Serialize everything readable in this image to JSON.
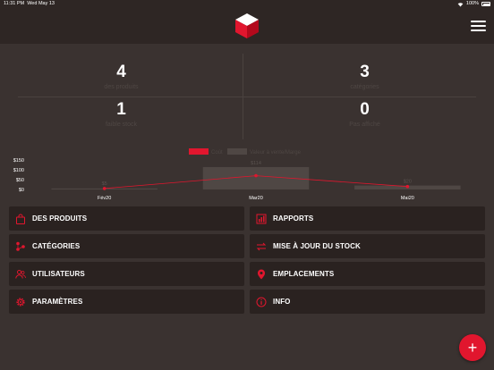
{
  "status": {
    "time": "11:31 PM",
    "date": "Wed May 13",
    "battery": "100%"
  },
  "colors": {
    "accent": "#e1162e",
    "background": "#3a3230",
    "header": "#2e2624",
    "tile": "#2a2220"
  },
  "stats": [
    {
      "value": "4",
      "label": "des produits"
    },
    {
      "value": "3",
      "label": "catégories"
    },
    {
      "value": "1",
      "label": "faible stock"
    },
    {
      "value": "0",
      "label": "Pas affiché"
    }
  ],
  "chart_data": {
    "type": "bar",
    "legend": [
      "Coût",
      "Valeur à vente/Marge"
    ],
    "categories": [
      "Fév20",
      "Mar20",
      "Mai20"
    ],
    "series": [
      {
        "name": "Coût",
        "type": "line",
        "values": [
          5,
          70,
          15
        ]
      },
      {
        "name": "Valeur à vente/Marge",
        "type": "bar",
        "values": [
          5,
          114,
          20
        ]
      }
    ],
    "bar_labels": [
      "",
      "$114",
      "$20"
    ],
    "point_labels": [
      "$5",
      "",
      ""
    ],
    "yticks": [
      "$150",
      "$100",
      "$50",
      "$0"
    ],
    "ylim": [
      0,
      150
    ],
    "grid": false
  },
  "tiles": [
    {
      "label": "DES PRODUITS",
      "icon": "shopping-bag-icon"
    },
    {
      "label": "RAPPORTS",
      "icon": "reports-icon"
    },
    {
      "label": "CATÉGORIES",
      "icon": "categories-icon"
    },
    {
      "label": "MISE À JOUR DU STOCK",
      "icon": "swap-arrows-icon"
    },
    {
      "label": "UTILISATEURS",
      "icon": "users-icon"
    },
    {
      "label": "EMPLACEMENTS",
      "icon": "location-pin-icon"
    },
    {
      "label": "PARAMÈTRES",
      "icon": "gear-icon"
    },
    {
      "label": "INFO",
      "icon": "info-icon"
    }
  ],
  "fab": {
    "label": "+"
  }
}
